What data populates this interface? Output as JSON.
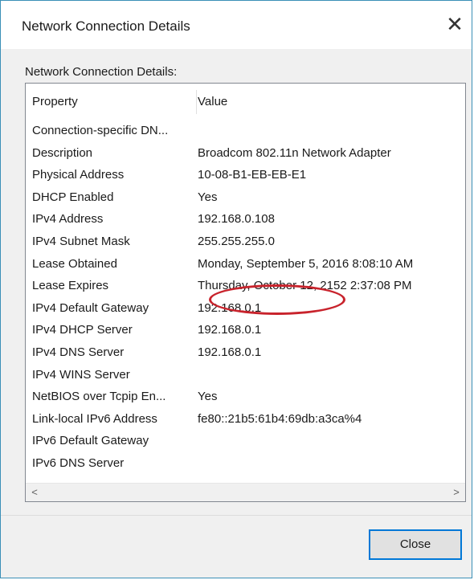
{
  "window": {
    "title": "Network Connection Details",
    "close_glyph": "✕"
  },
  "group": {
    "label": "Network Connection Details:"
  },
  "list": {
    "columns": [
      "Property",
      "Value"
    ],
    "rows": [
      {
        "property": "Connection-specific DN...",
        "value": ""
      },
      {
        "property": "Description",
        "value": "Broadcom 802.11n Network Adapter"
      },
      {
        "property": "Physical Address",
        "value": "10-08-B1-EB-EB-E1"
      },
      {
        "property": "DHCP Enabled",
        "value": "Yes"
      },
      {
        "property": "IPv4 Address",
        "value": "192.168.0.108"
      },
      {
        "property": "IPv4 Subnet Mask",
        "value": "255.255.255.0"
      },
      {
        "property": "Lease Obtained",
        "value": "Monday, September 5, 2016 8:08:10 AM"
      },
      {
        "property": "Lease Expires",
        "value": "Thursday, October 12, 2152 2:37:08 PM"
      },
      {
        "property": "IPv4 Default Gateway",
        "value": "192.168.0.1"
      },
      {
        "property": "IPv4 DHCP Server",
        "value": "192.168.0.1"
      },
      {
        "property": "IPv4 DNS Server",
        "value": "192.168.0.1"
      },
      {
        "property": "IPv4 WINS Server",
        "value": ""
      },
      {
        "property": "NetBIOS over Tcpip En...",
        "value": "Yes"
      },
      {
        "property": "Link-local IPv6 Address",
        "value": "fe80::21b5:61b4:69db:a3ca%4"
      },
      {
        "property": "IPv6 Default Gateway",
        "value": ""
      },
      {
        "property": "IPv6 DNS Server",
        "value": ""
      }
    ],
    "scroll_left_glyph": "<",
    "scroll_right_glyph": ">"
  },
  "buttons": {
    "close_label": "Close"
  },
  "colors": {
    "window_border": "#3a8fb7",
    "highlight_ellipse": "#c8232c",
    "button_focus": "#0078d7"
  },
  "icons": {
    "title_close": "close-icon",
    "scroll_left": "chevron-left-icon",
    "scroll_right": "chevron-right-icon"
  }
}
